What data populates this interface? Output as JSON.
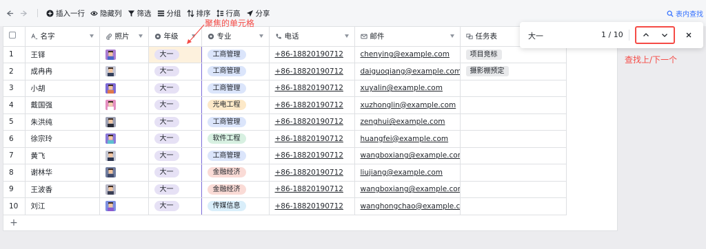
{
  "toolbar": {
    "insert_row": "插入一行",
    "hide_columns": "隐藏列",
    "filter": "筛选",
    "group": "分组",
    "sort": "排序",
    "row_height": "行高",
    "share": "分享",
    "find_in_table": "表内查找"
  },
  "columns": {
    "name": "名字",
    "photo": "照片",
    "grade": "年级",
    "major": "专业",
    "phone": "电话",
    "email": "邮件",
    "task": "任务表"
  },
  "rows": [
    {
      "num": "1",
      "name": "王铎",
      "grade": "大一",
      "major": "工商管理",
      "phone": "+86-18820190712",
      "email": "chenying@example.com",
      "task": "项目竞标",
      "avatar_bg": "#a97bd1",
      "avatar_face": "#f2c5a0",
      "avatar_body": "#4a66c8",
      "major_color": "blue"
    },
    {
      "num": "2",
      "name": "成冉冉",
      "grade": "大一",
      "major": "工商管理",
      "phone": "+86-18820190712",
      "email": "daiguoqiang@example.com",
      "task": "摄影棚预定",
      "avatar_bg": "#c7c9d6",
      "avatar_face": "#f3c7a4",
      "avatar_body": "#35405c",
      "major_color": "blue"
    },
    {
      "num": "3",
      "name": "小胡",
      "grade": "大一",
      "major": "工商管理",
      "phone": "+86-18820190712",
      "email": "xuyalin@example.com",
      "task": "",
      "avatar_bg": "#7d6ad6",
      "avatar_face": "#f0c49f",
      "avatar_body": "#e07a4a",
      "major_color": "blue"
    },
    {
      "num": "4",
      "name": "戴国强",
      "grade": "大一",
      "major": "光电工程",
      "phone": "+86-18820190712",
      "email": "xuzhonglin@example.com",
      "task": "",
      "avatar_bg": "#e48ec0",
      "avatar_face": "#f4cfae",
      "avatar_body": "#ffffff",
      "major_color": "yellow"
    },
    {
      "num": "5",
      "name": "朱洪纯",
      "grade": "大一",
      "major": "工商管理",
      "phone": "+86-18820190712",
      "email": "zenghui@example.com",
      "task": "",
      "avatar_bg": "#9da1b3",
      "avatar_face": "#f1c7a5",
      "avatar_body": "#2a2d3a",
      "major_color": "blue"
    },
    {
      "num": "6",
      "name": "徐宗玲",
      "grade": "大一",
      "major": "软件工程",
      "phone": "+86-18820190712",
      "email": "huangfei@example.com",
      "task": "",
      "avatar_bg": "#8a78d8",
      "avatar_face": "#f3c9a3",
      "avatar_body": "#5ec0d0",
      "major_color": "green"
    },
    {
      "num": "7",
      "name": "黄飞",
      "grade": "大一",
      "major": "工商管理",
      "phone": "+86-18820190712",
      "email": "wangboxiang@example.com",
      "task": "",
      "avatar_bg": "#c4c7d3",
      "avatar_face": "#f2c6a2",
      "avatar_body": "#2b3550",
      "major_color": "blue"
    },
    {
      "num": "8",
      "name": "谢林华",
      "grade": "大一",
      "major": "金融经济",
      "phone": "+86-18820190712",
      "email": "liujiang@example.com",
      "task": "",
      "avatar_bg": "#6f7c9e",
      "avatar_face": "#f0c39e",
      "avatar_body": "#3f4a6b",
      "major_color": "red"
    },
    {
      "num": "9",
      "name": "王波香",
      "grade": "大一",
      "major": "金融经济",
      "phone": "+86-18820190712",
      "email": "wangboxiang@example.com",
      "task": "",
      "avatar_bg": "#b8b8c6",
      "avatar_face": "#f3c8a4",
      "avatar_body": "#3a3f55",
      "major_color": "red"
    },
    {
      "num": "10",
      "name": "刘江",
      "grade": "大一",
      "major": "传媒信息",
      "phone": "+86-18820190712",
      "email": "wanghongchao@example.c...",
      "task": "",
      "avatar_bg": "#7c8fe0",
      "avatar_face": "#f2c5a0",
      "avatar_body": "#8a5bd0",
      "major_color": "cyan"
    }
  ],
  "find": {
    "query": "大一",
    "count": "1 / 10"
  },
  "annotations": {
    "focused_cell": "聚焦的单元格",
    "find_nav": "查找上/下一个"
  },
  "add_row_symbol": "+",
  "colors": {
    "accent": "#3370ff",
    "annotation_red": "#f54a45",
    "focus_border": "#7a6bd8",
    "focused_cell_bg": "#fdf1dd"
  }
}
